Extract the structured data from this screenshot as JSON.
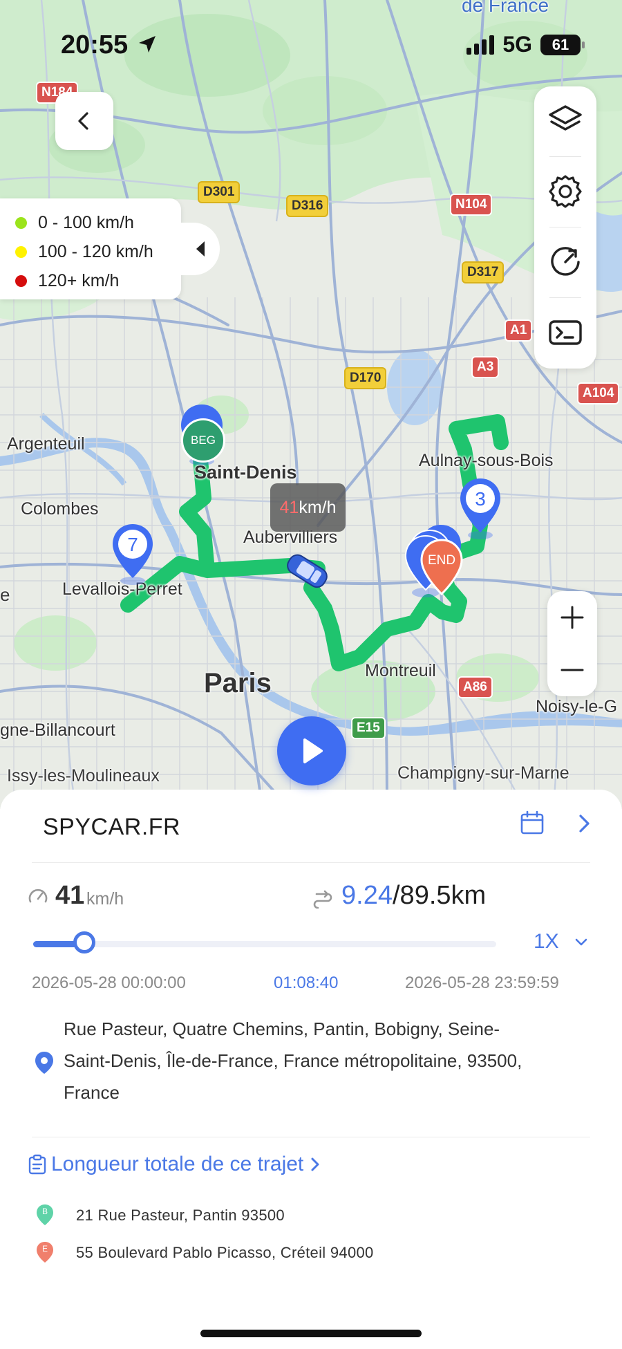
{
  "status_bar": {
    "time": "20:55",
    "network": "5G",
    "battery": "61"
  },
  "map": {
    "top_label": "de France",
    "legend": [
      {
        "label": "0 - 100 km/h",
        "color": "#9be41b"
      },
      {
        "label": "100 - 120 km/h",
        "color": "#fff200"
      },
      {
        "label": "120+ km/h",
        "color": "#d50d0d"
      }
    ],
    "places": {
      "argenteuil": "Argenteuil",
      "saint_denis": "Saint-Denis",
      "aulnay": "Aulnay-sous-Bois",
      "colombes": "Colombes",
      "aubervilliers": "Aubervilliers",
      "levallois": "Levallois-Perret",
      "paris": "Paris",
      "montreuil": "Montreuil",
      "noisy": "Noisy-le-G",
      "billancourt": "gne-Billancourt",
      "issy": "Issy-les-Moulineaux",
      "champigny": "Champigny-sur-Marne",
      "edge_e": "e"
    },
    "roads": {
      "n184": "N184",
      "d301": "D301",
      "d316": "D316",
      "n104": "N104",
      "d317": "D317",
      "a1": "A1",
      "d170": "D170",
      "a3": "A3",
      "a104": "A104",
      "a86": "A86",
      "e15": "E15"
    },
    "markers": {
      "begin": "BEG",
      "end": "END",
      "stop_3": "3",
      "stop_7": "7"
    },
    "speed_tip": {
      "value": "41",
      "unit": "km/h"
    },
    "route_color": "#1fc46e",
    "accent": "#3f6df2"
  },
  "panel": {
    "title": "SPYCAR.FR",
    "speed": {
      "value": "41",
      "unit": "km/h"
    },
    "distance": {
      "current": "9.24",
      "total": "/89.5km"
    },
    "progress": 0.11,
    "rate": "1X",
    "time_start": "2026-05-28 00:00:00",
    "time_current": "01:08:40",
    "time_end": "2026-05-28 23:59:59",
    "address_line1": "Rue Pasteur, Quatre Chemins, Pantin, Bobigny, Seine-",
    "address_line2": "Saint-Denis, Île-de-France, France métropolitaine, 93500,",
    "address_line3": "France",
    "total_link": "Longueur totale de ce trajet",
    "start_letter": "B",
    "end_letter": "E",
    "start_address": "21 Rue Pasteur, Pantin 93500",
    "end_address": "55 Boulevard Pablo Picasso, Créteil 94000"
  }
}
